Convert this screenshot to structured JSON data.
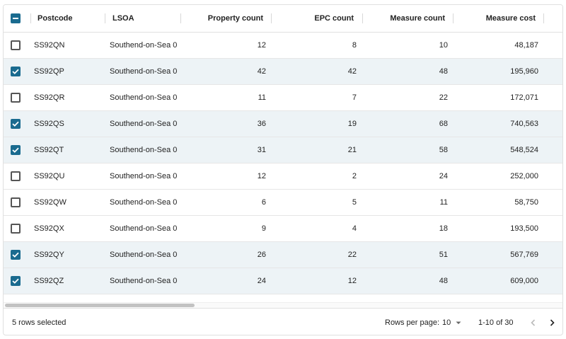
{
  "columns": {
    "postcode": "Postcode",
    "lsoa": "LSOA",
    "property_count": "Property count",
    "epc_count": "EPC count",
    "measure_count": "Measure count",
    "measure_cost": "Measure cost"
  },
  "header_checkbox_state": "indeterminate",
  "rows": [
    {
      "selected": false,
      "postcode": "SS92QN",
      "lsoa": "Southend-on-Sea 0…",
      "property_count": "12",
      "epc_count": "8",
      "measure_count": "10",
      "measure_cost": "48,187"
    },
    {
      "selected": true,
      "postcode": "SS92QP",
      "lsoa": "Southend-on-Sea 0…",
      "property_count": "42",
      "epc_count": "42",
      "measure_count": "48",
      "measure_cost": "195,960"
    },
    {
      "selected": false,
      "postcode": "SS92QR",
      "lsoa": "Southend-on-Sea 0…",
      "property_count": "11",
      "epc_count": "7",
      "measure_count": "22",
      "measure_cost": "172,071"
    },
    {
      "selected": true,
      "postcode": "SS92QS",
      "lsoa": "Southend-on-Sea 0…",
      "property_count": "36",
      "epc_count": "19",
      "measure_count": "68",
      "measure_cost": "740,563"
    },
    {
      "selected": true,
      "postcode": "SS92QT",
      "lsoa": "Southend-on-Sea 0…",
      "property_count": "31",
      "epc_count": "21",
      "measure_count": "58",
      "measure_cost": "548,524"
    },
    {
      "selected": false,
      "postcode": "SS92QU",
      "lsoa": "Southend-on-Sea 0…",
      "property_count": "12",
      "epc_count": "2",
      "measure_count": "24",
      "measure_cost": "252,000"
    },
    {
      "selected": false,
      "postcode": "SS92QW",
      "lsoa": "Southend-on-Sea 0…",
      "property_count": "6",
      "epc_count": "5",
      "measure_count": "11",
      "measure_cost": "58,750"
    },
    {
      "selected": false,
      "postcode": "SS92QX",
      "lsoa": "Southend-on-Sea 0…",
      "property_count": "9",
      "epc_count": "4",
      "measure_count": "18",
      "measure_cost": "193,500"
    },
    {
      "selected": true,
      "postcode": "SS92QY",
      "lsoa": "Southend-on-Sea 0…",
      "property_count": "26",
      "epc_count": "22",
      "measure_count": "51",
      "measure_cost": "567,769"
    },
    {
      "selected": true,
      "postcode": "SS92QZ",
      "lsoa": "Southend-on-Sea 0…",
      "property_count": "24",
      "epc_count": "12",
      "measure_count": "48",
      "measure_cost": "609,000"
    }
  ],
  "footer": {
    "selected_text": "5 rows selected",
    "rows_per_page_label": "Rows per page:",
    "rows_per_page_value": "10",
    "range_text": "1-10 of 30"
  },
  "icons": {
    "prev": "chevron-left-icon",
    "next": "chevron-right-icon",
    "dropdown": "caret-down-icon"
  },
  "colors": {
    "accent": "#1a6b8f",
    "selected_row": "#edf3f6"
  }
}
